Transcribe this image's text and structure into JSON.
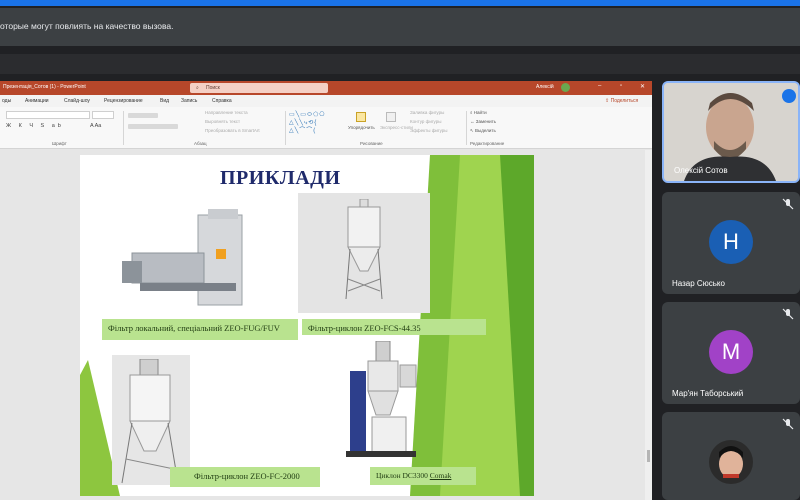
{
  "notification": {
    "text": "оторые могут повлиять на качество вызова."
  },
  "powerpoint": {
    "document_title": "Презентація_Сотов (1) - PowerPoint",
    "search_placeholder": "Поиск",
    "user_name": "Алексій",
    "menu": [
      "оды",
      "Анимации",
      "Слайд-шоу",
      "Рецензирование",
      "Вид",
      "Запись",
      "Справка"
    ],
    "share_label": "Поделиться",
    "ribbon": {
      "font_group": "Шрифт",
      "paragraph_group": "Абзац",
      "drawing_group": "Рисование",
      "editing_group": "Редактирование",
      "paragraph_items": [
        "Направление текста",
        "Выровнять текст",
        "Преобразовать в SmartArt"
      ],
      "arrange_label": "Упорядочить",
      "quickstyles_label": "Экспресс-стили",
      "drawing_items": [
        "Заливка фигуры",
        "Контур фигуры",
        "Эффекты фигуры"
      ],
      "editing_items": [
        "Найти",
        "Заменить",
        "Выделить"
      ]
    }
  },
  "slide": {
    "title": "ПРИКЛАДИ",
    "captions": [
      "Фільтр локальний, спеціальний  ZEO-FUG/FUV",
      "Фільтр-циклон ZEO-FCS-44.35",
      "Фільтр-циклон ZEO-FC-2000",
      "Циклон DC3300 ",
      "Comak"
    ]
  },
  "participants": [
    {
      "name": "Олексій Сотов",
      "speaking": true
    },
    {
      "name": "Назар Сюсько",
      "initial": "Н",
      "color": "#1a5fb4"
    },
    {
      "name": "Мар'ян Таборський",
      "initial": "М",
      "color": "#a142c7"
    },
    {
      "name": "",
      "initial": ""
    }
  ],
  "colors": {
    "ppt_accent": "#b7472a",
    "slide_green": "#8dc63f",
    "title_navy": "#1f2a6b",
    "speaking_border": "#8ab4f8"
  }
}
